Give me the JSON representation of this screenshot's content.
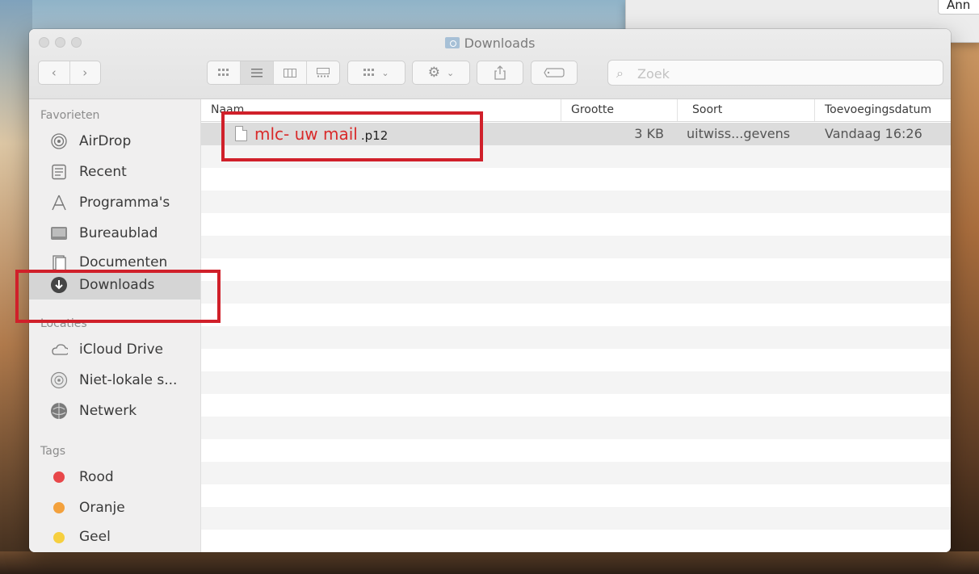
{
  "window": {
    "title": "Downloads"
  },
  "dialog": {
    "button_label": "Ann"
  },
  "toolbar": {
    "back_icon": "chevron-left-icon",
    "forward_icon": "chevron-right-icon",
    "views": [
      "icon-view",
      "list-view",
      "column-view",
      "gallery-view"
    ],
    "active_view": "list-view"
  },
  "search": {
    "placeholder": "Zoek",
    "value": ""
  },
  "sidebar": {
    "favorites_label": "Favorieten",
    "favorites": [
      {
        "label": "AirDrop",
        "icon": "airdrop-icon"
      },
      {
        "label": "Recent",
        "icon": "recent-icon"
      },
      {
        "label": "Programma's",
        "icon": "applications-icon"
      },
      {
        "label": "Bureaublad",
        "icon": "desktop-icon"
      },
      {
        "label": "Documenten",
        "icon": "documents-icon"
      },
      {
        "label": "Downloads",
        "icon": "downloads-icon",
        "selected": true
      }
    ],
    "locations_label": "Locaties",
    "locations": [
      {
        "label": "iCloud Drive",
        "icon": "icloud-icon"
      },
      {
        "label": "Niet-lokale s...",
        "icon": "remote-disc-icon"
      },
      {
        "label": "Netwerk",
        "icon": "network-icon"
      }
    ],
    "tags_label": "Tags",
    "tags": [
      {
        "label": "Rood",
        "color": "#e8474a"
      },
      {
        "label": "Oranje",
        "color": "#f3a13d"
      },
      {
        "label": "Geel",
        "color": "#f6cf3f"
      }
    ]
  },
  "list": {
    "columns": {
      "name": "Naam",
      "size": "Grootte",
      "kind": "Soort",
      "date_added": "Toevoegingsdatum"
    },
    "files": [
      {
        "name_main": "mlc-  uw mail",
        "name_ext": ".p12",
        "size": "3 KB",
        "kind": "uitwiss...gevens",
        "date_added": "Vandaag 16:26"
      }
    ]
  },
  "colors": {
    "annotation": "#d0202a",
    "filename_highlight": "#d92a2a"
  }
}
